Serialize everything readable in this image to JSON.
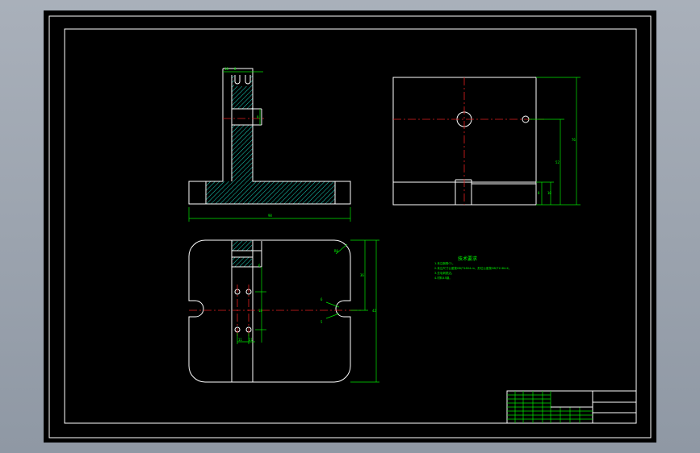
{
  "drawing": {
    "background": "#000000",
    "line_color": "#ffffff",
    "dimension_color": "#00e600",
    "centerline_color": "#e02020",
    "hatch_color": "#19d6c0",
    "dimensions": {
      "front_base_width": "98",
      "top_slot_a": "10",
      "top_slot_b": "8",
      "top_hole": "9",
      "side_total_height": "76",
      "side_hole_height": "52",
      "side_step_a": "8",
      "side_step_b": "10",
      "plan_height_a": "36",
      "plan_height_b": "42",
      "plan_radius": "R8",
      "plan_slot_a": "6",
      "plan_slot_b": "5",
      "plan_hole_pitch": "18",
      "plan_hole_offset": "13",
      "plan_hole_dia": "6",
      "plan_width_small": "11",
      "plan_width_small2": "11"
    }
  },
  "notes": {
    "title": "技术要求",
    "lines": [
      "1.未注倒角C1。",
      "2.未注尺寸公差按GB/T1804-m，形位公差按GB/T1184-K。",
      "3.去毛刺锐边。",
      "4.材料45钢。"
    ]
  },
  "title_block": {
    "rows": [
      "",
      "",
      "",
      "",
      "",
      "",
      "",
      ""
    ]
  }
}
